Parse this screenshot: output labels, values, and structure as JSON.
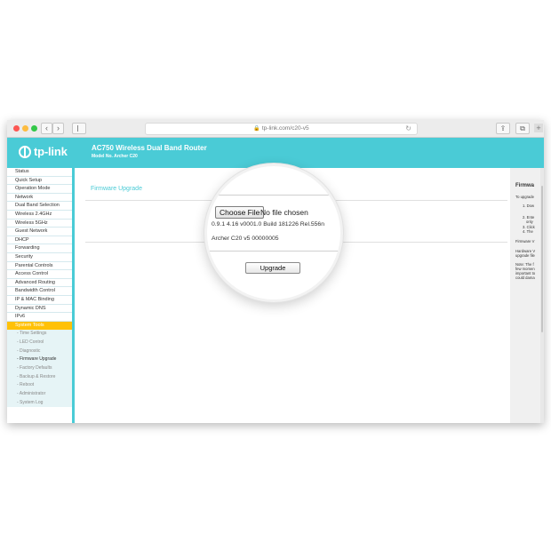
{
  "browser": {
    "url": "tp-link.com/c20-v5",
    "nav_back_icon": "‹",
    "nav_forward_icon": "›",
    "share_icon": "⇪",
    "tabs_icon": "⧉",
    "new_tab_icon": "+",
    "reload_icon": "↻",
    "lock_icon": "🔒"
  },
  "header": {
    "logo_text": "tp-link",
    "product_title": "AC750 Wireless Dual Band Router",
    "model": "Model No. Archer C20"
  },
  "sidebar": {
    "items": [
      {
        "label": "Status"
      },
      {
        "label": "Quick Setup"
      },
      {
        "label": "Operation Mode"
      },
      {
        "label": "Network"
      },
      {
        "label": "Dual Band Selection"
      },
      {
        "label": "Wireless 2.4GHz"
      },
      {
        "label": "Wireless 5GHz"
      },
      {
        "label": "Guest Network"
      },
      {
        "label": "DHCP"
      },
      {
        "label": "Forwarding"
      },
      {
        "label": "Security"
      },
      {
        "label": "Parental Controls"
      },
      {
        "label": "Access Control"
      },
      {
        "label": "Advanced Routing"
      },
      {
        "label": "Bandwidth Control"
      },
      {
        "label": "IP & MAC Binding"
      },
      {
        "label": "Dynamic DNS"
      },
      {
        "label": "IPv6"
      },
      {
        "label": "System Tools"
      }
    ],
    "subitems": [
      {
        "label": "- Time Settings"
      },
      {
        "label": "- LED Control"
      },
      {
        "label": "- Diagnostic"
      },
      {
        "label": "- Firmware Upgrade"
      },
      {
        "label": "- Factory Defaults"
      },
      {
        "label": "- Backup & Restore"
      },
      {
        "label": "- Reboot"
      },
      {
        "label": "- Administrator"
      },
      {
        "label": "- System Log"
      }
    ]
  },
  "main": {
    "section_title": "Firmware Upgrade",
    "file_label_fragment": "Fi",
    "choose_file_label": "Choose File",
    "no_file_text": "No file chosen",
    "firmware_version": "0.9.1 4.16 v0001.0 Build 181226 Rel.556n",
    "hardware_version": "Archer C20 v5 00000005",
    "upgrade_label": "Upgrade"
  },
  "help": {
    "title": "Firmwa",
    "lines": [
      "To upgrade",
      "1. Dow",
      "2. Ente",
      "only",
      "3. Click",
      "4. The",
      "Firmware V",
      "Hardware V",
      "upgrade file",
      "Note: The f",
      "few momen",
      "important to",
      "could dama"
    ]
  }
}
